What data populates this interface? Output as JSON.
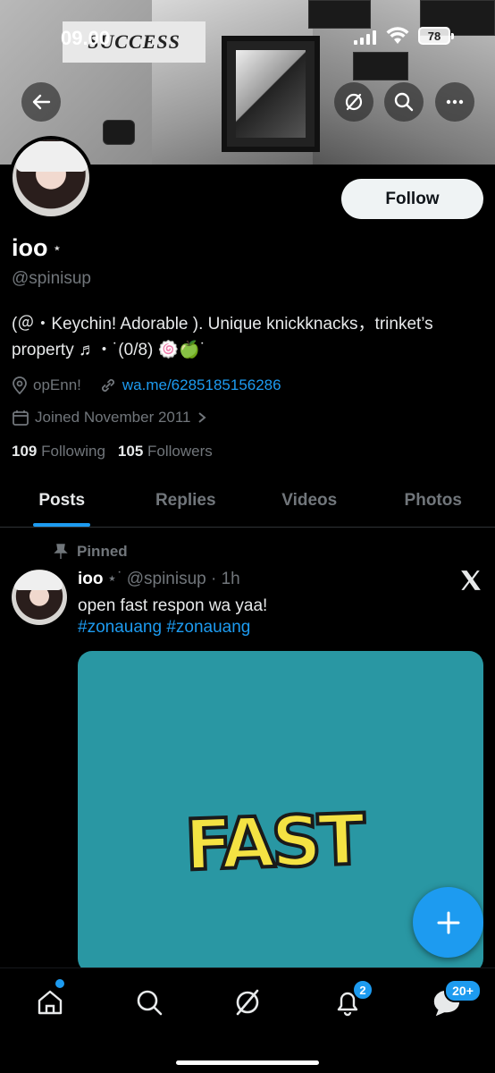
{
  "status_bar": {
    "time": "09.00",
    "battery": "78"
  },
  "banner": {
    "sign_text": "SUCCESS"
  },
  "profile": {
    "follow_label": "Follow",
    "display_name": "ioo",
    "name_suffix": "⋆",
    "handle": "@spinisup",
    "bio": "(＠・Keychin! Adorable ). Unique knickknacks，trinket’s property ♬・˙(0/8) 🍥🍏˙",
    "location": "opEnn!",
    "website": "wa.me/6285185156286",
    "joined": "Joined November 2011",
    "following_count": "109",
    "following_label": "Following",
    "followers_count": "105",
    "followers_label": "Followers"
  },
  "tabs": [
    {
      "label": "Posts",
      "active": true
    },
    {
      "label": "Replies",
      "active": false
    },
    {
      "label": "Videos",
      "active": false
    },
    {
      "label": "Photos",
      "active": false
    }
  ],
  "post": {
    "pinned_label": "Pinned",
    "author": "ioo",
    "author_suffix": "⋆˙",
    "handle_time": "@spinisup · 1h",
    "text": "open fast respon wa yaa!",
    "hashtags": "#zonauang #zonauang",
    "media_text": "FAST",
    "media_color": "#2997a3"
  },
  "bottom_nav": {
    "notifications_badge": "2",
    "messages_badge": "20+"
  },
  "colors": {
    "accent": "#1d9bf0",
    "background": "#000000",
    "muted": "#71767b"
  }
}
